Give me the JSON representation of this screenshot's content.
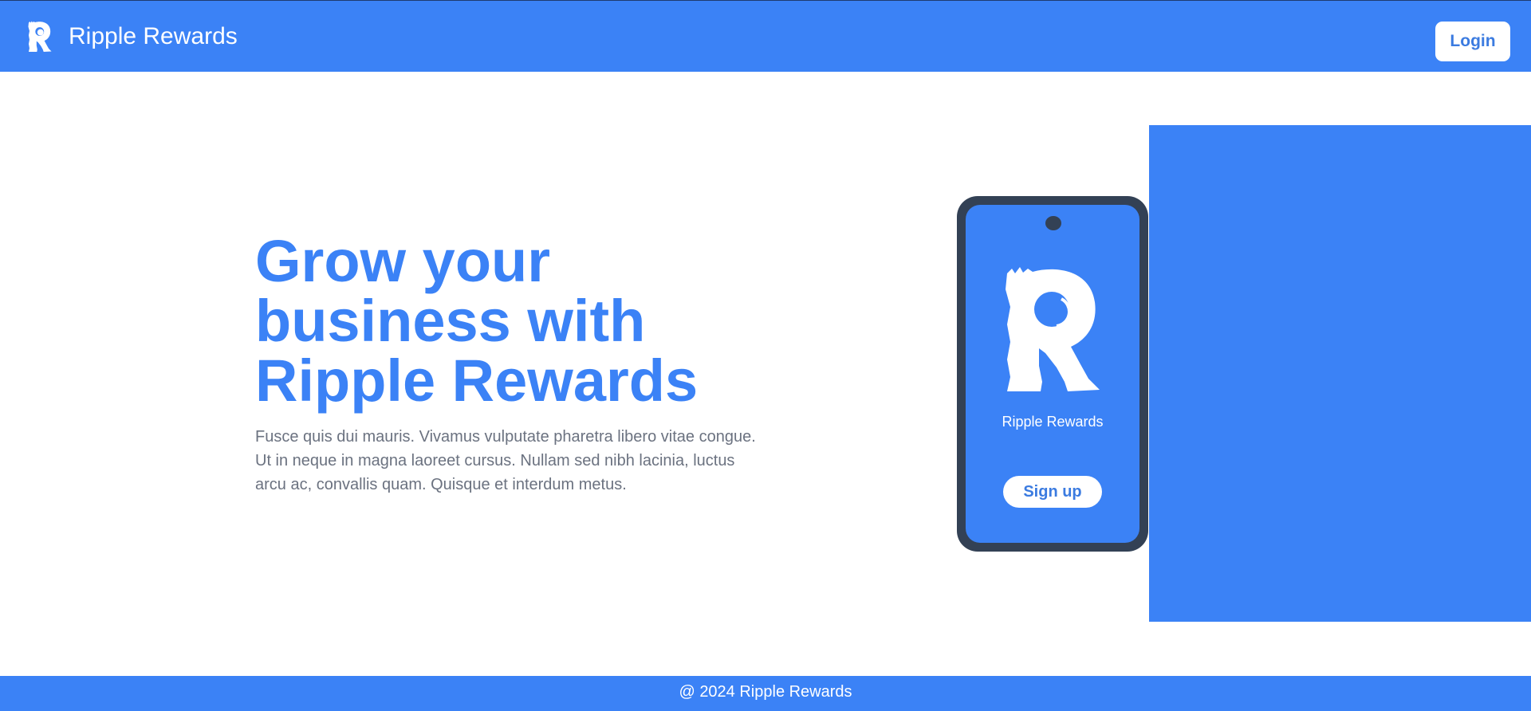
{
  "header": {
    "brand_name": "Ripple Rewards",
    "logo_icon": "ripple-r-logo-icon",
    "login_label": "Login"
  },
  "hero": {
    "title": "Grow your business with Ripple Rewards",
    "description": "Fusce quis dui mauris. Vivamus vulputate pharetra libero vitae congue. Ut in neque in magna laoreet cursus. Nullam sed nibh lacinia, luctus arcu ac, convallis quam. Quisque et interdum metus."
  },
  "phone": {
    "app_name": "Ripple Rewards",
    "signup_label": "Sign up"
  },
  "footer": {
    "copyright": "@ 2024 Ripple Rewards"
  },
  "colors": {
    "primary": "#3b82f6",
    "phone_frame": "#334155",
    "text_muted": "#6b7280",
    "background": "#ffffff"
  }
}
